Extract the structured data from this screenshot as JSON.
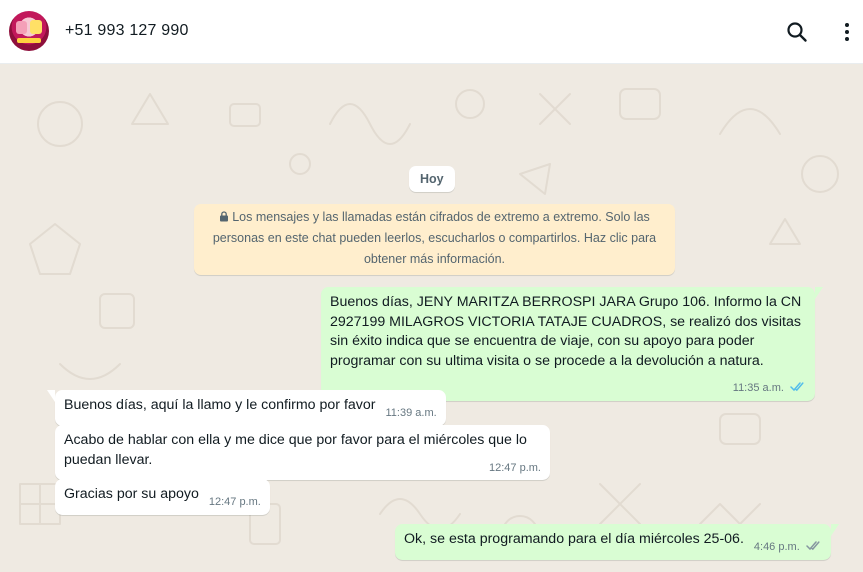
{
  "header": {
    "contact_name": "+51 993 127 990",
    "avatar_icon": "contact-avatar-icon",
    "search_icon": "search-icon",
    "menu_icon": "kebab-menu-icon"
  },
  "chat": {
    "date_chip": "Hoy",
    "encryption_notice": "Los mensajes y las llamadas están cifrados de extremo a extremo. Solo las personas en este chat pueden leerlos, escucharlos o compartirlos. Haz clic para obtener más información.",
    "messages": [
      {
        "direction": "outgoing",
        "text": "Buenos días, JENY MARITZA BERROSPI JARA Grupo 106. Informo la CN 2927199 MILAGROS VICTORIA TATAJE CUADROS, se realizó dos visitas sin éxito indica que se encuentra de viaje, con su apoyo para poder programar con su ultima visita o se procede a la devolución a natura.",
        "time": "11:35 a.m.",
        "status": "read"
      },
      {
        "direction": "incoming",
        "text": "Buenos días, aquí la llamo y le confirmo por favor",
        "time": "11:39 a.m."
      },
      {
        "direction": "incoming",
        "text": "Acabo de hablar con ella y me dice que por favor para el miércoles que lo puedan llevar.",
        "time": "12:47 p.m."
      },
      {
        "direction": "incoming",
        "text": "Gracias por su apoyo",
        "time": "12:47 p.m."
      },
      {
        "direction": "outgoing",
        "text": "Ok, se esta programando para el día miércoles 25-06.",
        "time": "4:46 p.m.",
        "status": "delivered"
      }
    ]
  },
  "colors": {
    "outgoing_bubble": "#d9fdd3",
    "incoming_bubble": "#ffffff",
    "wallpaper": "#efeae2",
    "read_ticks": "#53bdeb",
    "delivered_ticks": "#8696a0",
    "notice_bg": "#ffeecd"
  }
}
